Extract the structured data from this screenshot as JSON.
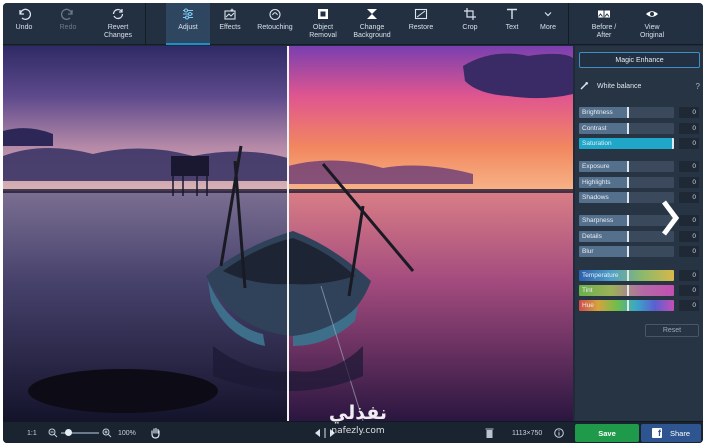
{
  "toolbar": {
    "undo": "Undo",
    "redo": "Redo",
    "revert": "Revert\nChanges",
    "adjust": "Adjust",
    "effects": "Effects",
    "retouching": "Retouching",
    "object_removal": "Object\nRemoval",
    "change_background": "Change\nBackground",
    "restore": "Restore",
    "crop": "Crop",
    "text": "Text",
    "more": "More",
    "before_after": "Before /\nAfter",
    "view_original": "View\nOriginal"
  },
  "panel": {
    "magic_enhance": "Magic Enhance",
    "white_balance": "White balance",
    "help": "?",
    "sliders": [
      {
        "label": "Brightness",
        "value": "0",
        "level": 0.5
      },
      {
        "label": "Contrast",
        "value": "0",
        "level": 0.5
      },
      {
        "label": "Saturation",
        "value": "0",
        "level": 1.0
      },
      {
        "label": "Exposure",
        "value": "0",
        "level": 0.5
      },
      {
        "label": "Highlights",
        "value": "0",
        "level": 0.5
      },
      {
        "label": "Shadows",
        "value": "0",
        "level": 0.5
      },
      {
        "label": "Sharpness",
        "value": "0",
        "level": 0.5
      },
      {
        "label": "Details",
        "value": "0",
        "level": 0.5
      },
      {
        "label": "Blur",
        "value": "0",
        "level": 0.5
      },
      {
        "label": "Temperature",
        "value": "0",
        "level": 0.5
      },
      {
        "label": "Tint",
        "value": "0",
        "level": 0.5
      },
      {
        "label": "Hue",
        "value": "0",
        "level": 0.5
      }
    ],
    "reset": "Reset"
  },
  "bottom": {
    "ratio": "1:1",
    "zoom": "100%",
    "dimensions": "1113×750",
    "save": "Save",
    "share": "Share",
    "fb": "f"
  },
  "watermark": {
    "arabic": "نفذلي",
    "latin": "nafezly.com"
  },
  "colors": {
    "accent": "#1e90c8",
    "save": "#1f9a4a",
    "share": "#2e5590"
  }
}
